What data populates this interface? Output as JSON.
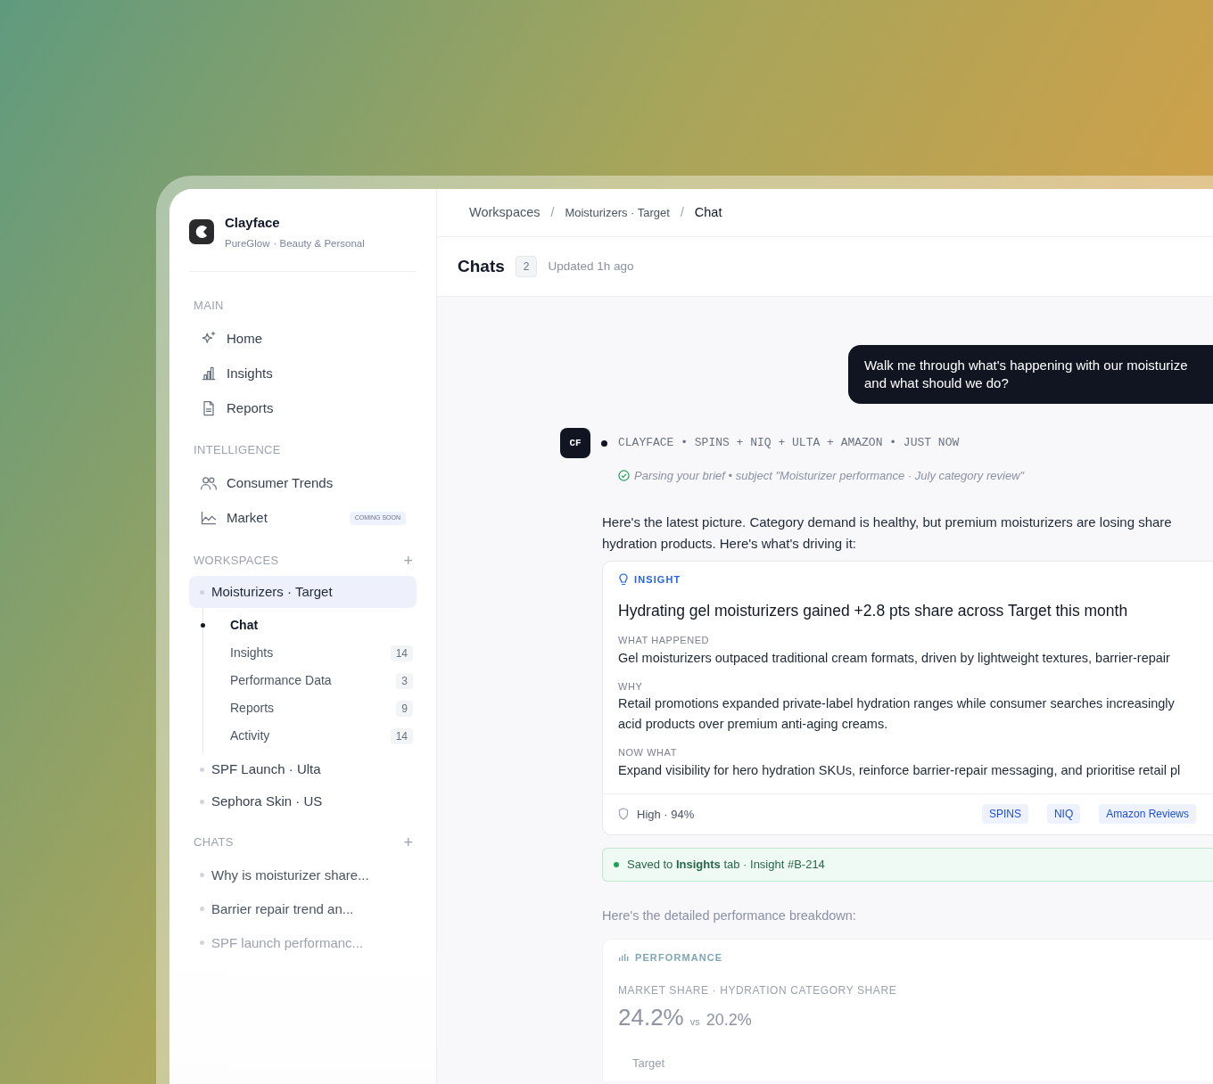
{
  "brand": {
    "name": "Clayface",
    "org": "PureGlow",
    "category": "· Beauty & Personal"
  },
  "sidebar": {
    "sections": [
      {
        "kind": "nav",
        "title": "MAIN",
        "items": [
          {
            "label": "Home"
          },
          {
            "label": "Insights"
          },
          {
            "label": "Reports"
          }
        ]
      },
      {
        "kind": "nav",
        "title": "INTELLIGENCE",
        "items": [
          {
            "label": "Consumer Trends"
          },
          {
            "label": "Market",
            "badge": "COMING SOON"
          }
        ]
      },
      {
        "kind": "workspaces",
        "title": "WORKSPACES",
        "add": "+",
        "items": [
          {
            "label": "Moisturizers · Target",
            "selected": true,
            "expanded": true,
            "children": [
              {
                "label": "Chat",
                "selected": true
              },
              {
                "label": "Insights",
                "selected": false,
                "count": "14"
              },
              {
                "label": "Performance Data",
                "selected": false,
                "count": "3"
              },
              {
                "label": "Reports",
                "selected": false,
                "count": "9"
              },
              {
                "label": "Activity",
                "selected": false,
                "count": "14"
              }
            ]
          },
          {
            "label": "SPF Launch · Ulta",
            "selected": false
          },
          {
            "label": "Sephora Skin · US",
            "selected": false
          }
        ]
      },
      {
        "kind": "chats",
        "title": "CHATS",
        "add": "+",
        "items": [
          {
            "label": "Why is moisturizer share..."
          },
          {
            "label": "Barrier repair trend an..."
          },
          {
            "label": "SPF launch performanc..."
          }
        ]
      }
    ]
  },
  "breadcrumb": [
    "Workspaces",
    "Moisturizers · Target",
    "Chat"
  ],
  "breadcrumb_separator": "/",
  "header": {
    "title": "Chats",
    "count": "2",
    "updated": "Updated 1h ago"
  },
  "chat": {
    "user_message": "Walk me through what's happening with our moisturize\nand what should we do?",
    "avatar": "CF",
    "meta": "CLAYFACE • SPINS + NIQ + ULTA + AMAZON • JUST NOW",
    "status": "Parsing your brief • subject \"Moisturizer performance · July category review\"",
    "intro": "Here's the latest picture. Category demand is healthy, but premium moisturizers are losing share\nhydration products. Here's what's driving it:",
    "insight": {
      "label": "INSIGHT",
      "title": "Hydrating gel moisturizers gained +2.8 pts share across Target this month",
      "sections": [
        {
          "heading": "WHAT HAPPENED",
          "text": "Gel moisturizers outpaced traditional cream formats, driven by lightweight textures, barrier-repair"
        },
        {
          "heading": "WHY",
          "text": "Retail promotions expanded private-label hydration ranges while consumer searches increasingly\nacid products over premium anti-aging creams."
        },
        {
          "heading": "NOW WHAT",
          "text": "Expand visibility for hero hydration SKUs, reinforce barrier-repair messaging, and prioritise retail pl"
        }
      ],
      "confidence": "High · 94%",
      "sources": [
        "SPINS",
        "NIQ",
        "Amazon Reviews"
      ]
    },
    "saved": "Saved to **Insights** tab · Insight #B-214",
    "breakdown_intro": "Here's the detailed performance breakdown:",
    "performance": {
      "label": "PERFORMANCE",
      "metric": "MARKET SHARE · HYDRATION CATEGORY SHARE",
      "value": "24.2%",
      "vs": "vs",
      "compare": "20.2%",
      "legend": "Target"
    }
  }
}
